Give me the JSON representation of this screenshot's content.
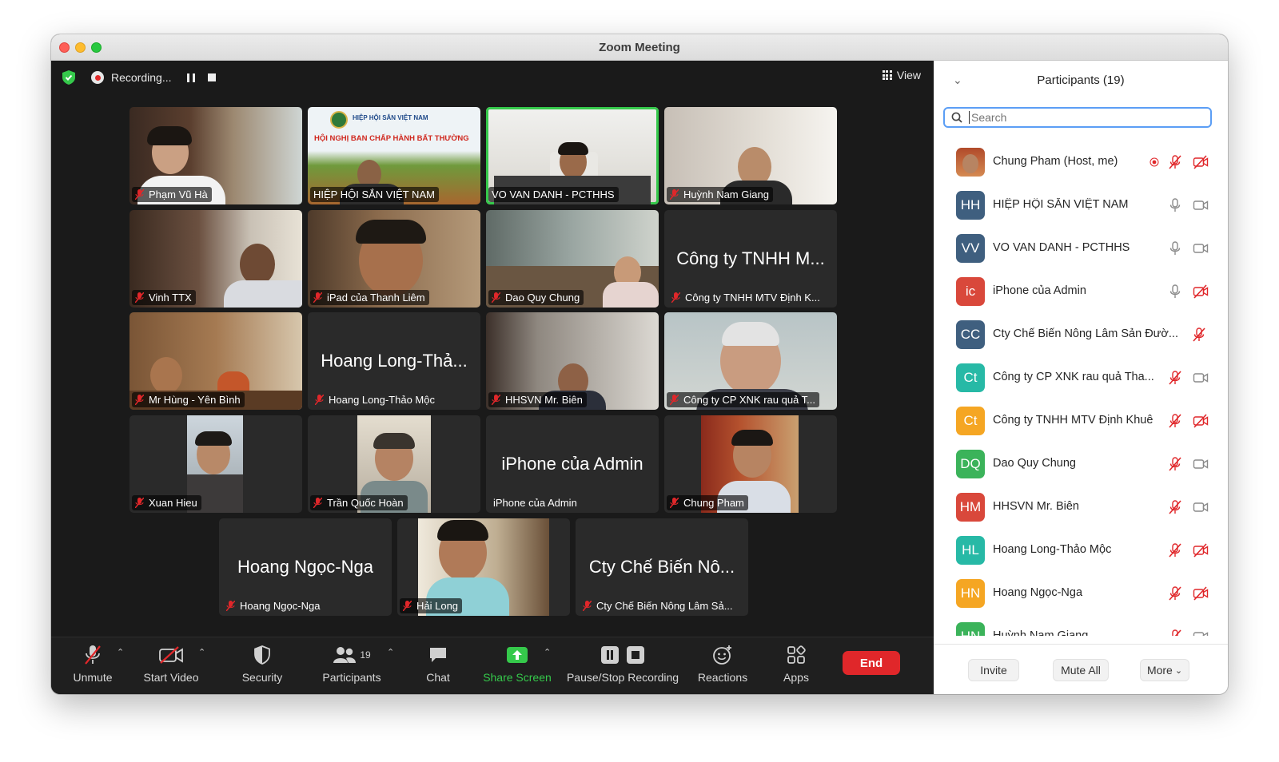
{
  "window": {
    "title": "Zoom Meeting"
  },
  "recording": {
    "status": "Recording..."
  },
  "view": {
    "label": "View"
  },
  "tiles": [
    {
      "name": "Phạm Vũ Hà",
      "muted": true
    },
    {
      "name": "HIỆP HỘI SẮN VIỆT NAM",
      "muted": false,
      "banner_org": "HIỆP HỘI SẮN VIỆT NAM",
      "banner_title": "HỘI NGHỊ BAN CHẤP HÀNH BẤT THƯỜNG"
    },
    {
      "name": "VO VAN DANH - PCTHHS",
      "muted": false,
      "active_speaker": true
    },
    {
      "name": "Huỳnh Nam Giang",
      "muted": true
    },
    {
      "name": "Vinh TTX",
      "muted": true
    },
    {
      "name": "iPad của Thanh Liêm",
      "muted": true
    },
    {
      "name": "Dao Quy Chung",
      "muted": true
    },
    {
      "name": "Công ty TNHH MTV Định K...",
      "big": "Công ty TNHH M...",
      "muted": true
    },
    {
      "name": "Mr Hùng - Yên Bình",
      "muted": true
    },
    {
      "name": "Hoang Long-Thảo Mộc",
      "big": "Hoang Long-Thả...",
      "muted": true
    },
    {
      "name": "HHSVN Mr. Biên",
      "muted": true
    },
    {
      "name": "Công ty CP XNK rau quả T...",
      "muted": true
    },
    {
      "name": "Xuan Hieu",
      "muted": true
    },
    {
      "name": "Trần Quốc Hoàn",
      "muted": true
    },
    {
      "name": "iPhone của Admin",
      "big": "iPhone của Admin",
      "muted": false
    },
    {
      "name": "Chung Pham",
      "muted": true
    },
    {
      "name": "Hoang Ngọc-Nga",
      "big": "Hoang Ngọc-Nga",
      "muted": true
    },
    {
      "name": "Hải Long",
      "muted": true
    },
    {
      "name": "Cty Chế Biến Nông Lâm Sả...",
      "big": "Cty Chế Biến Nô...",
      "muted": true
    }
  ],
  "toolbar": {
    "unmute": "Unmute",
    "start_video": "Start Video",
    "security": "Security",
    "participants": "Participants",
    "participants_count": "19",
    "chat": "Chat",
    "share_screen": "Share Screen",
    "pause_stop": "Pause/Stop Recording",
    "reactions": "Reactions",
    "apps": "Apps",
    "end": "End"
  },
  "panel": {
    "title": "Participants (19)",
    "search_placeholder": "Search",
    "participants": [
      {
        "initials": "",
        "name": "Chung Pham (Host, me)",
        "color": "#c77a3a",
        "photo": true,
        "mic": "muted",
        "video": "off",
        "recording": true
      },
      {
        "initials": "HH",
        "name": "HIỆP HỘI SẮN VIỆT NAM",
        "color": "#3f5f7f",
        "mic": "on",
        "video": "on"
      },
      {
        "initials": "VV",
        "name": "VO VAN DANH - PCTHHS",
        "color": "#3f5f7f",
        "mic": "on",
        "video": "on"
      },
      {
        "initials": "ic",
        "name": "iPhone của Admin",
        "color": "#d9483b",
        "mic": "on",
        "video": "off"
      },
      {
        "initials": "CC",
        "name": "Cty Chế Biến Nông Lâm Sản Đườ...",
        "color": "#3f5f7f",
        "mic": "muted",
        "video": "none"
      },
      {
        "initials": "Ct",
        "name": "Công ty CP XNK rau quả Tha...",
        "color": "#27b9a6",
        "mic": "muted",
        "video": "on"
      },
      {
        "initials": "Ct",
        "name": "Công ty TNHH MTV Định Khuê",
        "color": "#f5a623",
        "mic": "muted",
        "video": "off"
      },
      {
        "initials": "DQ",
        "name": "Dao Quy Chung",
        "color": "#3bb35a",
        "mic": "muted",
        "video": "on"
      },
      {
        "initials": "HM",
        "name": "HHSVN Mr. Biên",
        "color": "#d9483b",
        "mic": "muted",
        "video": "on"
      },
      {
        "initials": "HL",
        "name": "Hoang Long-Thảo Mộc",
        "color": "#27b9a6",
        "mic": "muted",
        "video": "off"
      },
      {
        "initials": "HN",
        "name": "Hoang Ngọc-Nga",
        "color": "#f5a623",
        "mic": "muted",
        "video": "off"
      },
      {
        "initials": "HN",
        "name": "Huỳnh Nam Giang",
        "color": "#3bb35a",
        "mic": "muted",
        "video": "on"
      }
    ],
    "invite": "Invite",
    "mute_all": "Mute All",
    "more": "More"
  },
  "colors": {
    "accent_green": "#35c94b",
    "end_red": "#e0272a",
    "mute_red": "#e0272a",
    "search_blue": "#5b9ef5"
  }
}
